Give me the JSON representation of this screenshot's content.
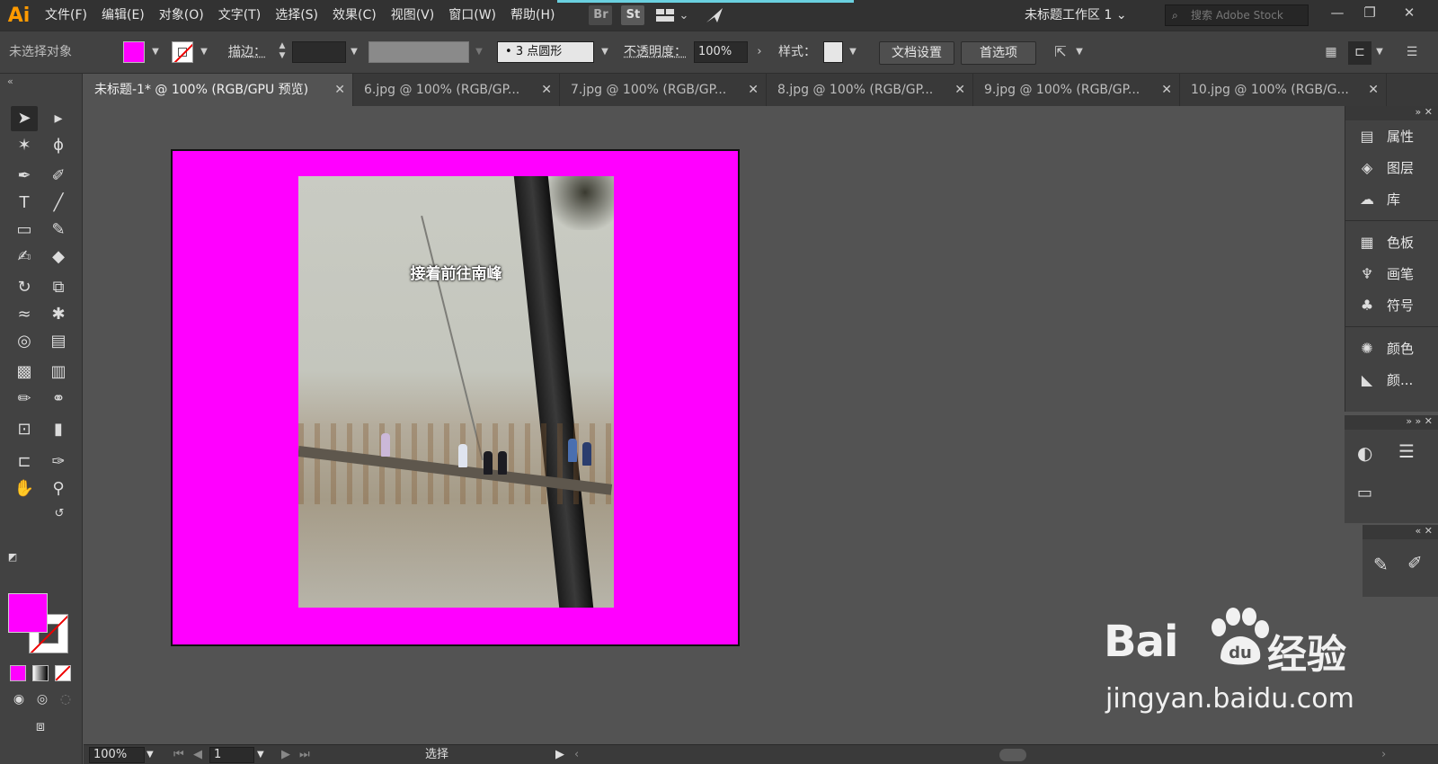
{
  "app": {
    "logo": "Ai"
  },
  "menu": [
    "文件(F)",
    "编辑(E)",
    "对象(O)",
    "文字(T)",
    "选择(S)",
    "效果(C)",
    "视图(V)",
    "窗口(W)",
    "帮助(H)"
  ],
  "app_buttons": {
    "bridge": "Br",
    "stock": "St"
  },
  "workspace": {
    "label": "未标题工作区 1"
  },
  "search": {
    "placeholder": "搜索 Adobe Stock"
  },
  "window_controls": {
    "minimize": "—",
    "restore": "❐",
    "close": "✕"
  },
  "control_bar": {
    "selection_status": "未选择对象",
    "fill_color": "#ff00ff",
    "stroke_label": "描边：",
    "brush": "3 点圆形",
    "opacity_label": "不透明度：",
    "opacity_value": "100%",
    "style_label": "样式：",
    "doc_setup": "文档设置",
    "preferences": "首选项"
  },
  "tabs": [
    {
      "label": "未标题-1* @ 100% (RGB/GPU 预览)",
      "active": true
    },
    {
      "label": "6.jpg @ 100% (RGB/GP...",
      "active": false
    },
    {
      "label": "7.jpg @ 100% (RGB/GP...",
      "active": false
    },
    {
      "label": "8.jpg @ 100% (RGB/GP...",
      "active": false
    },
    {
      "label": "9.jpg @ 100% (RGB/GP...",
      "active": false
    },
    {
      "label": "10.jpg @ 100% (RGB/G...",
      "active": false
    }
  ],
  "tab_close": "✕",
  "canvas": {
    "artboard_color": "#ff00ff",
    "photo_caption": "接着前往南峰"
  },
  "right_panel": {
    "items": [
      {
        "label": "属性",
        "icon": "properties-icon"
      },
      {
        "label": "图层",
        "icon": "layers-icon"
      },
      {
        "label": "库",
        "icon": "libraries-icon"
      },
      {
        "label": "色板",
        "icon": "swatches-icon"
      },
      {
        "label": "画笔",
        "icon": "brushes-icon"
      },
      {
        "label": "符号",
        "icon": "symbols-icon"
      },
      {
        "label": "颜色",
        "icon": "color-icon"
      },
      {
        "label": "颜...",
        "icon": "color-guide-icon"
      }
    ]
  },
  "status_bar": {
    "zoom": "100%",
    "page": "1",
    "tool": "选择"
  },
  "watermark": {
    "brand": "Bai",
    "brand_cn": "经验",
    "url": "jingyan.baidu.com"
  }
}
